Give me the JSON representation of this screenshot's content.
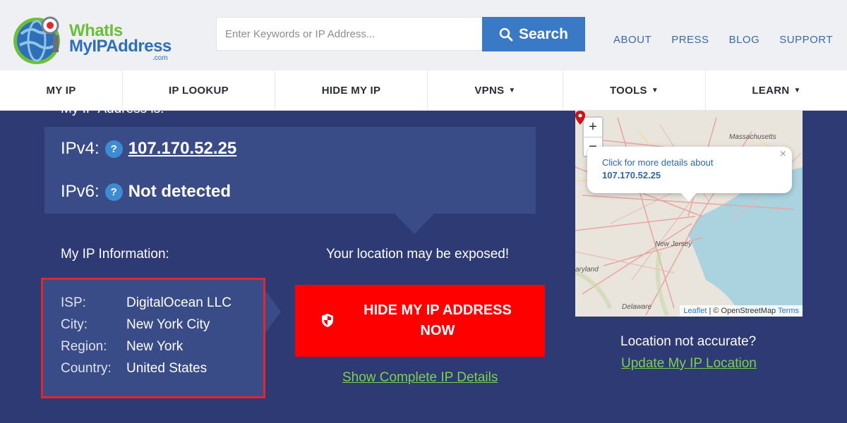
{
  "header": {
    "logo": {
      "line1": "WhatIs",
      "line2": "MyIPAddress",
      "dotcom": ".com"
    },
    "search": {
      "placeholder": "Enter Keywords or IP Address...",
      "button": "Search"
    },
    "links": [
      "ABOUT",
      "PRESS",
      "BLOG",
      "SUPPORT"
    ]
  },
  "nav": {
    "items": [
      {
        "label": "MY IP",
        "caret": ""
      },
      {
        "label": "IP LOOKUP",
        "caret": ""
      },
      {
        "label": "HIDE MY IP",
        "caret": ""
      },
      {
        "label": "VPNS",
        "caret": "▼"
      },
      {
        "label": "TOOLS",
        "caret": "▼"
      },
      {
        "label": "LEARN",
        "caret": "▼"
      }
    ]
  },
  "main": {
    "cut_label": "My IP Address is:",
    "ipv4": {
      "label": "IPv4:",
      "value": "107.170.52.25"
    },
    "ipv6": {
      "label": "IPv6:",
      "value": "Not detected"
    },
    "qmark": "?",
    "info_label": "My IP Information:",
    "exposed": "Your location may be exposed!",
    "info": [
      {
        "key": "ISP:",
        "value": "DigitalOcean LLC"
      },
      {
        "key": "City:",
        "value": "New York City"
      },
      {
        "key": "Region:",
        "value": "New York"
      },
      {
        "key": "Country:",
        "value": "United States"
      }
    ],
    "hide_button": {
      "line1": "HIDE MY IP ADDRESS",
      "line2": "NOW"
    },
    "show_details": "Show Complete IP Details"
  },
  "map": {
    "zoom_in": "+",
    "zoom_out": "−",
    "popup_line1": "Click for more details about",
    "popup_line2": "107.170.52.25",
    "close": "×",
    "labels": {
      "massachusetts": "Massachusetts",
      "new_jersey": "New Jersey",
      "maryland": "aryland",
      "delaware": "Delaware"
    },
    "attribution": {
      "leaflet": "Leaflet",
      "sep": " | © OpenStreetMap ",
      "terms": "Terms"
    }
  },
  "location": {
    "not_accurate": "Location not accurate?",
    "update": "Update My IP Location"
  },
  "colors": {
    "brand_blue": "#3979c6",
    "brand_green": "#6cbf3b",
    "panel": "#2d3a73",
    "cta_red": "#fe0000",
    "link_green": "#7ed04d",
    "highlight_red": "#e3262c"
  }
}
